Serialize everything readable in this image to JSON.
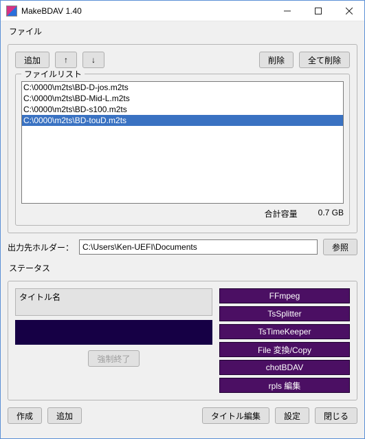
{
  "window": {
    "title": "MakeBDAV 1.40"
  },
  "file_section": {
    "label": "ファイル",
    "buttons": {
      "add": "追加",
      "up": "↑",
      "down": "↓",
      "delete": "削除",
      "delete_all": "全て削除"
    },
    "list_label": "ファイルリスト",
    "files": [
      "C:\\0000\\m2ts\\BD-D-jos.m2ts",
      "C:\\0000\\m2ts\\BD-Mid-L.m2ts",
      "C:\\0000\\m2ts\\BD-s100.m2ts",
      "C:\\0000\\m2ts\\BD-touD.m2ts"
    ],
    "selected_index": 3,
    "total_label": "合計容量",
    "total_value": "0.7 GB"
  },
  "output": {
    "label": "出力先ホルダー：",
    "value": "C:\\Users\\Ken-UEFI\\Documents",
    "browse": "参照"
  },
  "status": {
    "label": "ステータス",
    "title_name_label": "タイトル名",
    "force_stop": "強制終了",
    "stages": [
      "FFmpeg",
      "TsSplitter",
      "TsTimeKeeper",
      "File 変換/Copy",
      "chotBDAV",
      "rpls 編集"
    ]
  },
  "bottom": {
    "create": "作成",
    "add": "追加",
    "title_edit": "タイトル編集",
    "settings": "設定",
    "close": "閉じる"
  }
}
